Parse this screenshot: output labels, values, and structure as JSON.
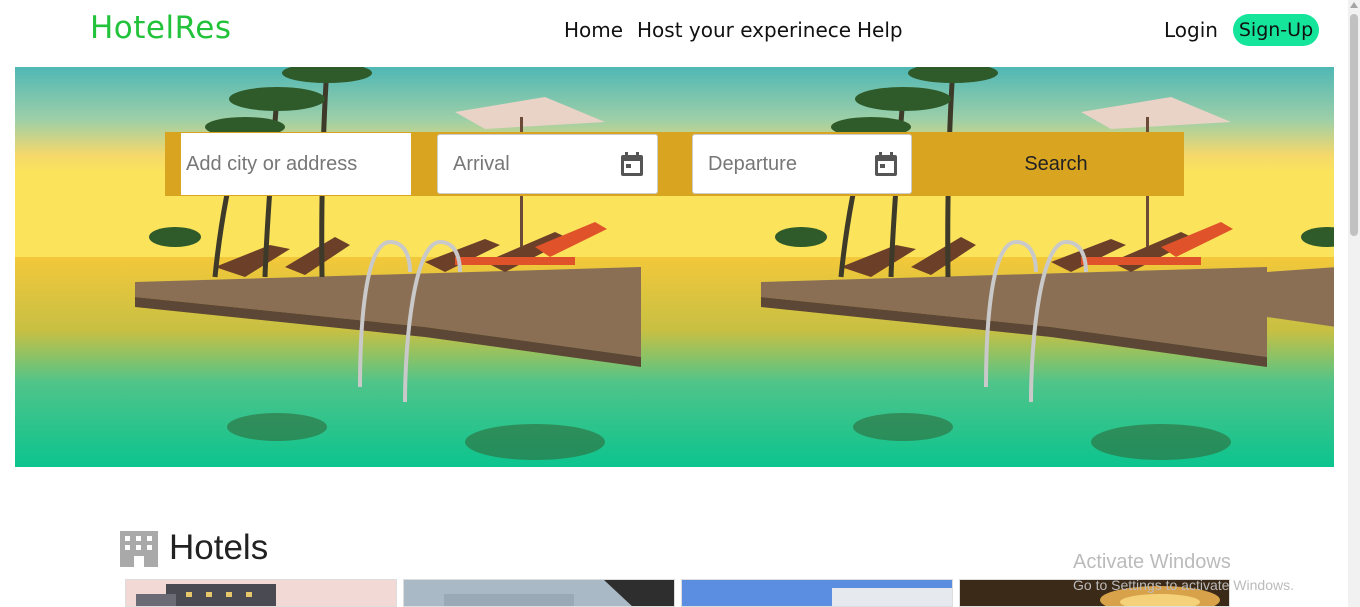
{
  "brand": {
    "name": "HotelRes",
    "color": "#22c33a"
  },
  "nav": {
    "home": "Home",
    "host": "Host your experinece",
    "help": "Help"
  },
  "auth": {
    "login": "Login",
    "signup": "Sign-Up",
    "signup_color": "#14e59b"
  },
  "search": {
    "city_placeholder": "Add city or address",
    "arrival_placeholder": "Arrival",
    "departure_placeholder": "Departure",
    "button": "Search",
    "bar_color": "#d9a521"
  },
  "hero": {
    "image": "tropical resort pool with sun loungers at sunset"
  },
  "hotels": {
    "title": "Hotels",
    "icon": "building-icon",
    "cards": [
      {
        "image": "hotel building exterior"
      },
      {
        "image": "modern glass building"
      },
      {
        "image": "blue sky building"
      },
      {
        "image": "chandelier interior"
      }
    ]
  },
  "watermark": {
    "title": "Activate Windows",
    "subtitle": "Go to Settings to activate Windows."
  }
}
